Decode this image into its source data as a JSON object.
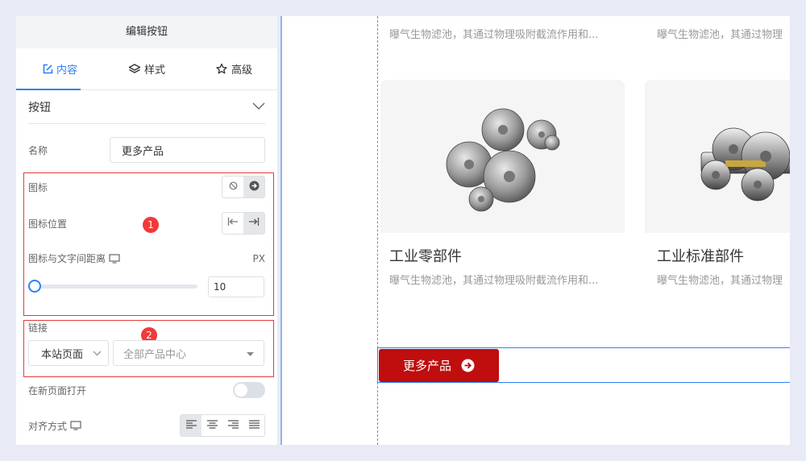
{
  "panel": {
    "title": "编辑按钮",
    "tabs": [
      {
        "label": "内容",
        "icon": "edit-icon",
        "active": true
      },
      {
        "label": "样式",
        "icon": "layers-icon",
        "active": false
      },
      {
        "label": "高级",
        "icon": "star-gear-icon",
        "active": false
      }
    ],
    "section": {
      "label": "按钮"
    },
    "name": {
      "label": "名称",
      "value": "更多产品"
    },
    "icon_field": {
      "label": "图标"
    },
    "icon_position": {
      "label": "图标位置"
    },
    "icon_spacing": {
      "label": "图标与文字间距离",
      "unit": "PX",
      "value": "10",
      "slider_level": 0
    },
    "link": {
      "label": "链接",
      "type": "本站页面",
      "target": "全部产品中心"
    },
    "new_page": {
      "label": "在新页面打开",
      "on": false
    },
    "align": {
      "label": "对齐方式"
    },
    "badges": [
      "1",
      "2"
    ],
    "accent": "#2d7ff9",
    "highlight": "#e03c3c"
  },
  "preview": {
    "top_desc_left": "曝气生物滤池，其通过物理吸附截流作用和...",
    "top_desc_right": "曝气生物滤池，其通过物理",
    "cards": [
      {
        "title": "工业零部件",
        "desc": "曝气生物滤池，其通过物理吸附截流作用和..."
      },
      {
        "title": "工业标准部件",
        "desc": "曝气生物滤池，其通过物理"
      }
    ],
    "button_label": "更多产品",
    "button_color": "#c00d0d"
  }
}
